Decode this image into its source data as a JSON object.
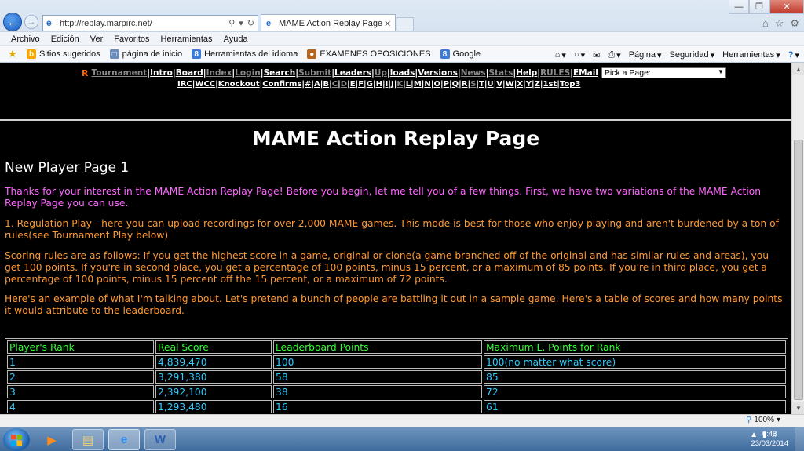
{
  "browser": {
    "url": "http://replay.marpirc.net/",
    "tab_title": "MAME Action Replay Page",
    "menu": [
      "Archivo",
      "Edición",
      "Ver",
      "Favoritos",
      "Herramientas",
      "Ayuda"
    ],
    "favorites": [
      {
        "label": "Sitios sugeridos",
        "icon": "b-icon",
        "color": "#f7a800"
      },
      {
        "label": "página de inicio",
        "icon": "page-icon",
        "color": "#6b8bb8"
      },
      {
        "label": "Herramientas del idioma",
        "icon": "google-icon",
        "color": "#3a7bd5"
      },
      {
        "label": "EXAMENES OPOSICIONES",
        "icon": "person-icon",
        "color": "#b5651d"
      },
      {
        "label": "Google",
        "icon": "google-icon",
        "color": "#3a7bd5"
      }
    ],
    "commands": {
      "page": "Página",
      "security": "Seguridad",
      "tools": "Herramientas"
    },
    "zoom": "100%"
  },
  "site_nav": {
    "row1": [
      {
        "label": "Tournament",
        "dim": true
      },
      {
        "label": "Intro",
        "dim": false
      },
      {
        "label": "Board",
        "dim": false
      },
      {
        "label": "Index",
        "dim": true
      },
      {
        "label": "Login",
        "dim": true
      },
      {
        "label": "Search",
        "dim": false
      },
      {
        "label": "Submit",
        "dim": true
      },
      {
        "label": "Leaders",
        "dim": false
      },
      {
        "label": "Up",
        "dim": true
      },
      {
        "label": "loads",
        "dim": false
      },
      {
        "label": "Versions",
        "dim": false
      },
      {
        "label": "News",
        "dim": true
      },
      {
        "label": "Stats",
        "dim": true
      },
      {
        "label": "Help",
        "dim": false
      },
      {
        "label": "RULES",
        "dim": true
      },
      {
        "label": "EMail",
        "dim": false
      }
    ],
    "logo_letter": "R",
    "pick_placeholder": "Pick a Page:",
    "row2": [
      "IRC",
      "WCC",
      "Knockout",
      "Confirms",
      "#",
      "A",
      "B",
      "C",
      "D",
      "E",
      "F",
      "G",
      "H",
      "I",
      "J",
      "K",
      "L",
      "M",
      "N",
      "O",
      "P",
      "Q",
      "R",
      "S",
      "T",
      "U",
      "V",
      "W",
      "X",
      "Y",
      "Z",
      "1st",
      "Top3"
    ],
    "row2_dim": [
      "C",
      "D",
      "K",
      "S"
    ]
  },
  "content": {
    "title": "MAME Action Replay Page",
    "subtitle": "New Player Page 1",
    "intro": "Thanks for your interest in the MAME Action Replay Page!  Before you begin, let me tell you of a few things.  First, we have two variations of the MAME Action Replay Page you can use.",
    "regulation": "1.  Regulation Play - here you can upload recordings for over 2,000 MAME games.  This mode is best for those who enjoy playing and aren't burdened by a ton of rules(see Tournament Play below)",
    "scoring": "Scoring rules are as follows:  If you get the highest score in a game, original or clone(a game branched off of the original and has similar rules and areas), you get 100 points.  If you're in second place, you get a percentage of 100 points, minus 15 percent, or a maximum of 85 points.  If you're in third place, you get a percentage of 100 points, minus 15 percent off the 15 percent, or a maximum of 72 points.",
    "example": "Here's an example of what I'm talking about.  Let's pretend a bunch of people are battling it out in a sample game.  Here's a table of scores and how many points it would attribute to the leaderboard."
  },
  "table": {
    "headers": [
      "Player's Rank",
      "Real Score",
      "Leaderboard Points",
      "Maximum L. Points for Rank"
    ],
    "rows": [
      [
        "1",
        "4,839,470",
        "100",
        "100(no matter what score)"
      ],
      [
        "2",
        "3,291,380",
        "58",
        "85"
      ],
      [
        "3",
        "2,392,100",
        "38",
        "72"
      ],
      [
        "4",
        "1,293,480",
        "16",
        "61"
      ]
    ]
  },
  "taskbar": {
    "time": "0:43",
    "date": "23/03/2014"
  }
}
